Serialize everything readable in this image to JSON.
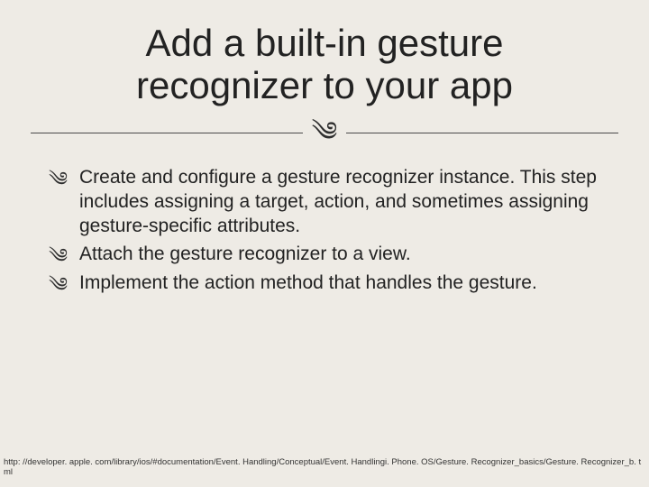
{
  "title": "Add a built-in gesture recognizer to your app",
  "flourish": "༄",
  "bullet_glyph": "༄",
  "items": [
    "Create and configure a gesture recognizer instance. This step includes assigning a target, action, and sometimes assigning gesture-specific attributes.",
    "Attach the gesture recognizer to a view.",
    "Implement the action method that handles the gesture."
  ],
  "footer_url": "http: //developer. apple. com/library/ios/#documentation/Event. Handling/Conceptual/Event. Handlingi. Phone. OS/Gesture. Recognizer_basics/Gesture. Recognizer_b. tml"
}
